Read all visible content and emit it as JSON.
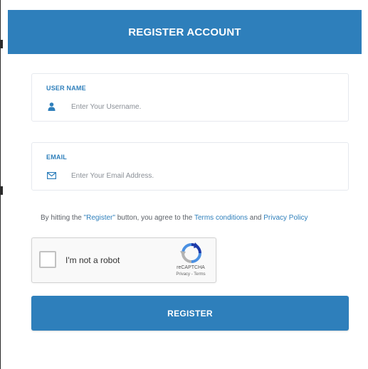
{
  "header": {
    "title": "REGISTER ACCOUNT"
  },
  "username": {
    "label": "USER NAME",
    "placeholder": "Enter Your Username.",
    "value": "",
    "icon": "user-icon"
  },
  "email": {
    "label": "EMAIL",
    "placeholder": "Enter Your Email Address.",
    "value": "",
    "icon": "envelope-icon"
  },
  "terms": {
    "prefix": "By hitting the ",
    "register_link": "\"Register\"",
    "middle": " button, you agree to the ",
    "terms_link": "Terms conditions",
    "conjunction": " and ",
    "privacy_link": "Privacy Policy"
  },
  "captcha": {
    "label": "I'm not a robot",
    "brand": "reCAPTCHA",
    "privacy": "Privacy",
    "terms": "Terms",
    "separator": " - ",
    "checked": false
  },
  "register_button": {
    "label": "REGISTER"
  },
  "colors": {
    "accent": "#2e7fbb",
    "header_text": "#ffffff",
    "placeholder": "#8a8f96"
  }
}
